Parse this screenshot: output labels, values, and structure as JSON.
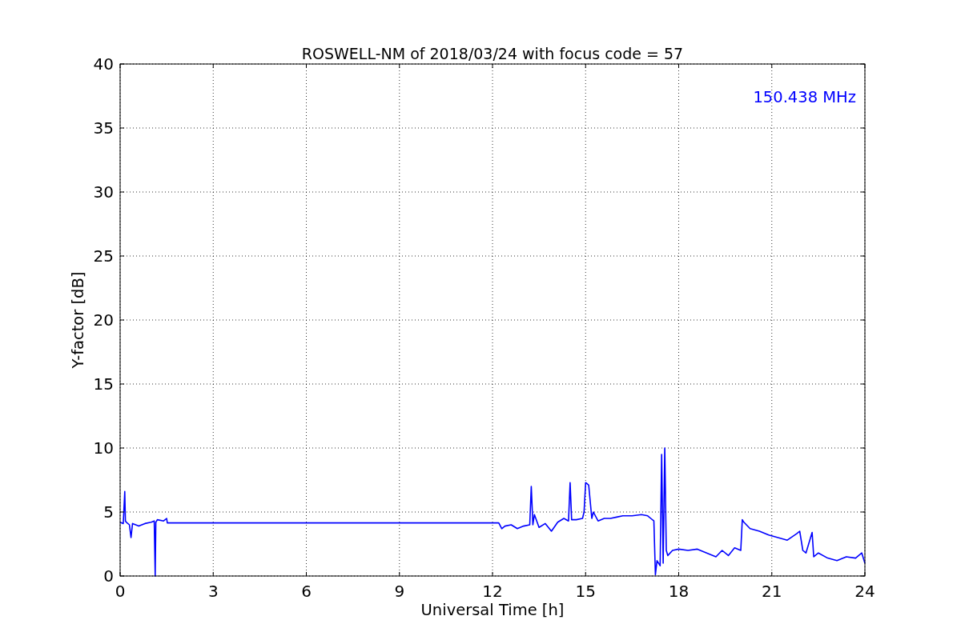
{
  "chart_data": {
    "type": "line",
    "title": "ROSWELL-NM of 2018/03/24 with focus code = 57",
    "xlabel": "Universal Time [h]",
    "ylabel": "Y-factor [dB]",
    "xlim": [
      0,
      24
    ],
    "ylim": [
      0,
      40
    ],
    "xticks": [
      0,
      3,
      6,
      9,
      12,
      15,
      18,
      21,
      24
    ],
    "yticks": [
      0,
      5,
      10,
      15,
      20,
      25,
      30,
      35,
      40
    ],
    "x": [
      0,
      0.1,
      0.15,
      0.17,
      0.2,
      0.3,
      0.35,
      0.4,
      0.6,
      0.8,
      1.0,
      1.1,
      1.13,
      1.15,
      1.2,
      1.4,
      1.5,
      1.52,
      12.2,
      12.3,
      12.4,
      12.6,
      12.8,
      13.0,
      13.2,
      13.25,
      13.3,
      13.35,
      13.5,
      13.7,
      13.9,
      14.1,
      14.3,
      14.45,
      14.5,
      14.55,
      14.7,
      14.9,
      14.95,
      15.0,
      15.1,
      15.2,
      15.25,
      15.4,
      15.6,
      15.8,
      16.0,
      16.2,
      16.5,
      16.8,
      17.0,
      17.1,
      17.2,
      17.25,
      17.3,
      17.4,
      17.45,
      17.5,
      17.55,
      17.6,
      17.65,
      17.8,
      18.0,
      18.3,
      18.6,
      18.9,
      19.2,
      19.4,
      19.6,
      19.8,
      20.0,
      20.05,
      20.1,
      20.3,
      20.6,
      20.9,
      21.2,
      21.5,
      21.8,
      21.9,
      22.0,
      22.1,
      22.3,
      22.35,
      22.5,
      22.8,
      23.1,
      23.4,
      23.7,
      23.9,
      24
    ],
    "series": [
      {
        "name": "150.438 MHz",
        "color": "#0000ff",
        "values": [
          4.2,
          4.1,
          6.6,
          4.3,
          4.2,
          4.0,
          3.0,
          4.1,
          3.9,
          4.1,
          4.2,
          4.3,
          0,
          4.2,
          4.4,
          4.3,
          4.5,
          4.15,
          4.15,
          3.7,
          3.9,
          4.0,
          3.7,
          3.9,
          4.0,
          7.0,
          4.0,
          4.8,
          3.8,
          4.1,
          3.5,
          4.2,
          4.5,
          4.3,
          7.3,
          4.4,
          4.4,
          4.5,
          5.0,
          7.3,
          7.1,
          4.5,
          5.0,
          4.3,
          4.5,
          4.5,
          4.6,
          4.7,
          4.7,
          4.8,
          4.7,
          4.5,
          4.3,
          0.1,
          1.2,
          0.8,
          9.5,
          1.0,
          10.0,
          2.0,
          1.6,
          2.0,
          2.1,
          2.0,
          2.1,
          1.8,
          1.5,
          2.0,
          1.6,
          2.2,
          2.0,
          4.4,
          4.2,
          3.7,
          3.5,
          3.2,
          3.0,
          2.8,
          3.3,
          3.5,
          2.0,
          1.8,
          3.4,
          1.5,
          1.8,
          1.4,
          1.2,
          1.5,
          1.4,
          1.8,
          1.0
        ]
      }
    ],
    "grid": true
  }
}
